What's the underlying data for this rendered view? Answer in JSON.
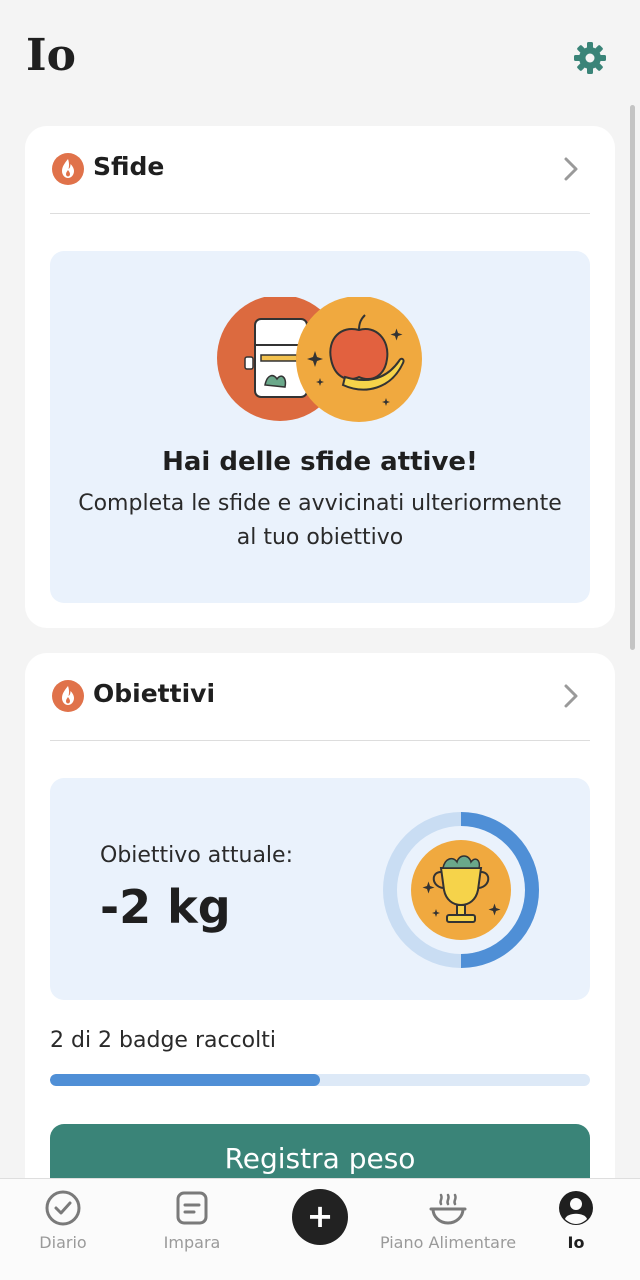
{
  "header": {
    "title": "Io",
    "settings_icon": "gear-icon"
  },
  "colors": {
    "accent": "#3a8478",
    "flame": "#e0724a",
    "progress": "#4f8fd6",
    "panel": "#eaf2fc"
  },
  "challenges": {
    "title": "Sfide",
    "heading": "Hai delle sfide attive!",
    "description": "Completa le sfide e avvicinati ulteriormente al tuo obiettivo"
  },
  "goals": {
    "title": "Obiettivi",
    "current_label": "Obiettivo attuale:",
    "current_value": "-2 kg",
    "badges_text": "2 di 2 badge raccolti",
    "badges_progress_percent": 50,
    "button_label": "Registra peso"
  },
  "tabbar": {
    "items": [
      {
        "label": "Diario",
        "icon": "check-circle-icon"
      },
      {
        "label": "Impara",
        "icon": "note-icon"
      },
      {
        "label": "",
        "icon": "plus-icon"
      },
      {
        "label": "Piano Alimentare",
        "icon": "bowl-icon"
      },
      {
        "label": "Io",
        "icon": "profile-icon",
        "active": true
      }
    ]
  }
}
